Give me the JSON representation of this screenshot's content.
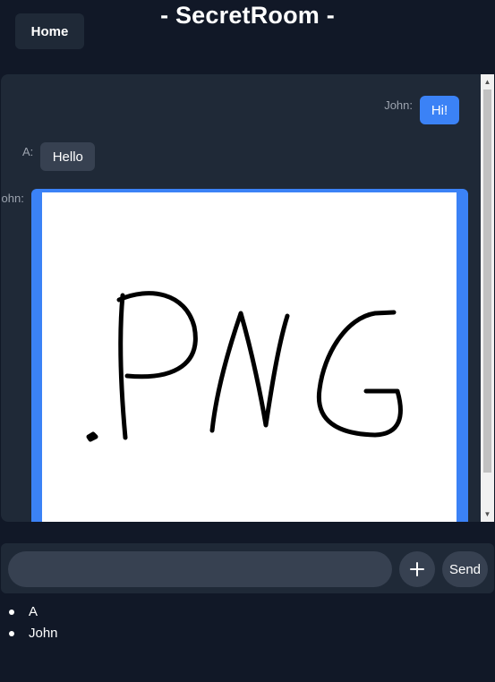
{
  "header": {
    "home_label": "Home",
    "title": "- SecretRoom -"
  },
  "messages": [
    {
      "sender": "John:",
      "text": "Hi!",
      "align": "right",
      "bubble_color": "#3b82f6"
    },
    {
      "sender": "A:",
      "text": "Hello",
      "align": "left",
      "bubble_color": "#374151"
    },
    {
      "sender": "John:",
      "type": "image",
      "image_text": ".PNG",
      "bubble_color": "#3b82f6"
    }
  ],
  "composer": {
    "placeholder": "",
    "value": "",
    "add_icon": "plus-icon",
    "send_label": "Send"
  },
  "users": [
    "A",
    "John"
  ],
  "colors": {
    "page_bg": "#111827",
    "panel_bg": "#1f2937",
    "control_bg": "#374151",
    "accent": "#3b82f6",
    "muted_text": "#9ca3af"
  }
}
